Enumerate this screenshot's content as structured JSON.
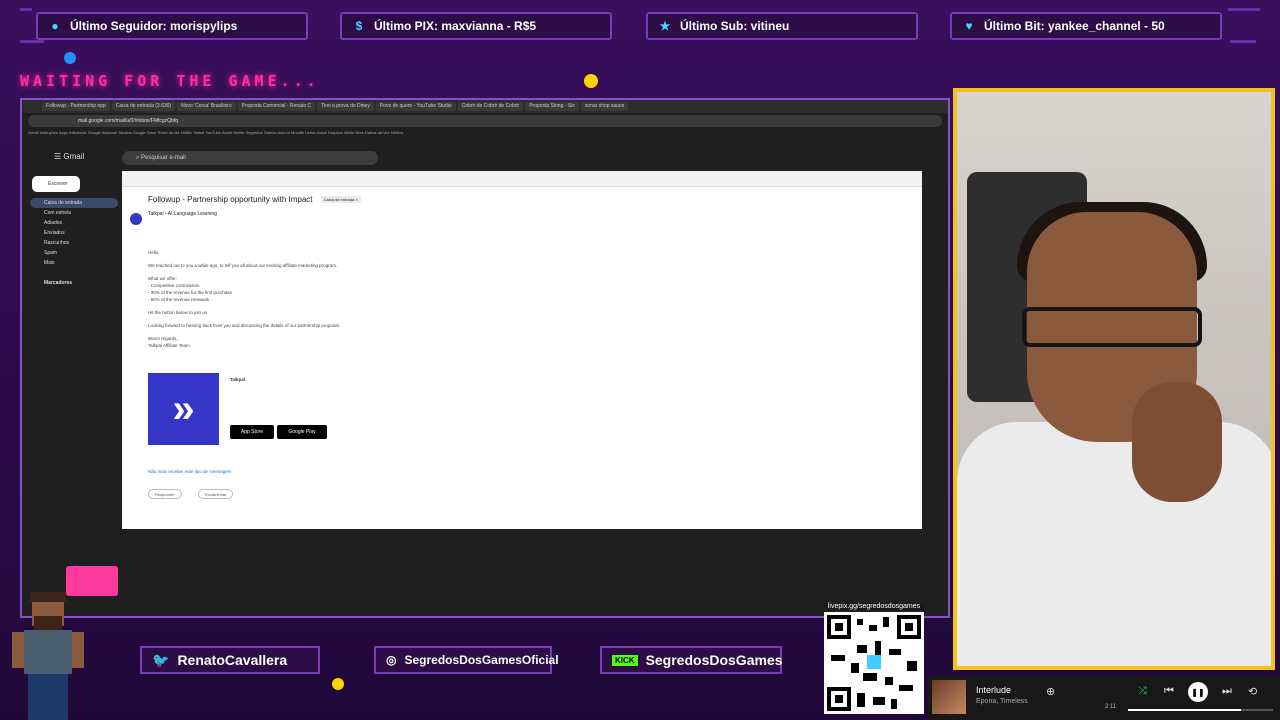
{
  "overlay": {
    "top_pills": [
      {
        "icon": "person-icon",
        "label": "Último Seguidor: morispylips"
      },
      {
        "icon": "dollar-icon",
        "label": "Último PIX: maxvianna - R$5"
      },
      {
        "icon": "star-icon",
        "label": "Último Sub: vitineu"
      },
      {
        "icon": "diamond-icon",
        "label": "Último Bit: yankee_channel - 50"
      }
    ],
    "waiting_text": "WAITING FOR THE GAME...",
    "socials": [
      {
        "icon": "twitter-icon",
        "label": "RenatoCavallera"
      },
      {
        "icon": "instagram-icon",
        "label": "SegredosDosGamesOficial"
      },
      {
        "icon": "kick-icon",
        "badge": "KICK",
        "label": "SegredosDosGames"
      }
    ],
    "qr_caption": "livepix.gg/segredosdosgames",
    "accent": "#7a3bb8",
    "pink": "#ff2e9a",
    "webcam_border": "#f4c21e"
  },
  "browser": {
    "tabs": [
      "Followup - Partnership opp",
      "Caixa de entrada (3.630)",
      "Novo 'Corsa' Brasileiro",
      "Proposta Comercial - Renato C",
      "Tirei a prova do Diney",
      "Povo de quem - YouTube Studio",
      "Cobrir de Cobrir de Cobrir",
      "Proposta Siring - Sis",
      "sonar shop sauce"
    ],
    "url": "mail.google.com/mail/u/0/#inbox/FMfcgzQbfq",
    "bookmarks": "Gmail  Instruções  Apps  Influencer  Google Adsense  Studios  Google Drive  Ticket do dia  Netflix  Twitch  YouTube  Aneel  Netflix  Segredos Games  Acervo  Moodle  Linha chave  Dropbox  Midia  Sites  Dados da Vez  Nelhos"
  },
  "gmail": {
    "brand": "Gmail",
    "search_placeholder": "Pesquisar e-mail",
    "compose": "Escrever",
    "sidebar": [
      "Caixa de entrada",
      "Com estrela",
      "Adiados",
      "Enviados",
      "Rascunhos",
      "Spam",
      "Mais"
    ],
    "labels_header": "Marcadores",
    "subject": "Followup - Partnership opportunity with Impact",
    "subject_chip": "Caixa de entrada ×",
    "sender": "Talkpal - AI Language Learning",
    "greeting": "Hello,",
    "body_lines": [
      "We reached out to you a while ago, to tell you all about our exciting affiliate marketing program.",
      "What we offer:",
      "- Competitive commission",
      "- 30% of the revenue for the first purchase",
      "- 50% of the revenue renewals",
      "Hit the button below to join us",
      "Looking forward to hearing back from you and discussing the details of our partnership proposal.",
      "Warm regards,",
      "Talkpal Affiliate Team"
    ],
    "sig_name": "Talkpal",
    "store_buttons": [
      "App Store",
      "Google Play"
    ],
    "footer_note": "Não mais receber este tipo de mensagem",
    "reply": "Responder",
    "forward": "Encaminhar"
  },
  "music": {
    "song": "Interlude",
    "artist": "Epona, Timeless",
    "time": "2:11",
    "progress": 0.78
  }
}
